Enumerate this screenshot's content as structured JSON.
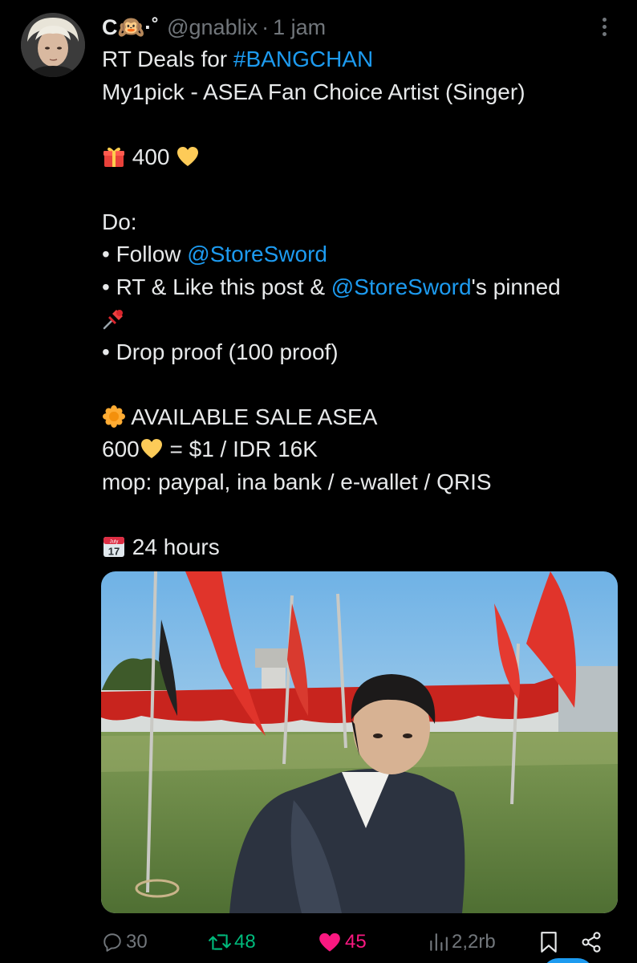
{
  "tweet": {
    "author_name": "C",
    "author_name_symbol": "🙉·˚",
    "handle": "@gnablix",
    "separator": "·",
    "time": "1 jam",
    "lines": {
      "l1_prefix": "RT Deals for ",
      "l1_hashtag": "#BANGCHAN",
      "l2": "My1pick - ASEA Fan Choice Artist (Singer)",
      "l3_amount": " 400 ",
      "l4": "Do:",
      "l5_prefix": "• Follow ",
      "l5_mention": "@StoreSword",
      "l6_prefix": "• RT & Like this post & ",
      "l6_mention": "@StoreSword",
      "l6_suffix": "'s pinned",
      "l8": "• Drop proof (100 proof)",
      "l9": " AVAILABLE SALE ASEA",
      "l10_a": "600",
      "l10_b": " = $1 / IDR 16K",
      "l11": "mop: paypal, ina bank / e-wallet / QRIS",
      "l12": " 24 hours"
    },
    "calendar_month": "July",
    "calendar_day": "17"
  },
  "actions": {
    "replies": "30",
    "retweets": "48",
    "likes": "45",
    "views": "2,2rb"
  },
  "icons": [
    "avatar-photo",
    "more-options-icon",
    "gift-emoji",
    "yellow-heart-emoji",
    "pushpin-emoji",
    "blossom-emoji",
    "calendar-emoji",
    "reply-icon",
    "retweet-icon",
    "like-heart-icon",
    "views-icon",
    "bookmark-icon",
    "share-icon"
  ],
  "colors": {
    "background": "#000000",
    "text": "#e7e9ea",
    "muted": "#71767b",
    "link": "#1d9bf0",
    "retweet": "#00ba7c",
    "like": "#f91880"
  }
}
